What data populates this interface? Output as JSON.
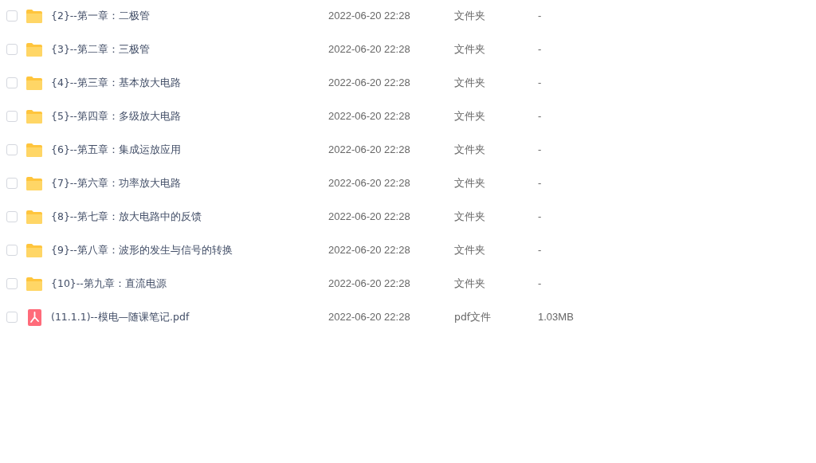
{
  "files": [
    {
      "kind": "folder",
      "checked": false,
      "name": "{2}--第一章：二极管",
      "modified": "2022-06-20 22:28",
      "type": "文件夹",
      "size": "-"
    },
    {
      "kind": "folder",
      "checked": false,
      "name": "{3}--第二章：三极管",
      "modified": "2022-06-20 22:28",
      "type": "文件夹",
      "size": "-"
    },
    {
      "kind": "folder",
      "checked": false,
      "name": "{4}--第三章：基本放大电路",
      "modified": "2022-06-20 22:28",
      "type": "文件夹",
      "size": "-"
    },
    {
      "kind": "folder",
      "checked": false,
      "name": "{5}--第四章：多级放大电路",
      "modified": "2022-06-20 22:28",
      "type": "文件夹",
      "size": "-"
    },
    {
      "kind": "folder",
      "checked": false,
      "name": "{6}--第五章：集成运放应用",
      "modified": "2022-06-20 22:28",
      "type": "文件夹",
      "size": "-"
    },
    {
      "kind": "folder",
      "checked": false,
      "name": "{7}--第六章：功率放大电路",
      "modified": "2022-06-20 22:28",
      "type": "文件夹",
      "size": "-"
    },
    {
      "kind": "folder",
      "checked": false,
      "name": "{8}--第七章：放大电路中的反馈",
      "modified": "2022-06-20 22:28",
      "type": "文件夹",
      "size": "-"
    },
    {
      "kind": "folder",
      "checked": false,
      "name": "{9}--第八章：波形的发生与信号的转换",
      "modified": "2022-06-20 22:28",
      "type": "文件夹",
      "size": "-"
    },
    {
      "kind": "folder",
      "checked": false,
      "name": "{10}--第九章：直流电源",
      "modified": "2022-06-20 22:28",
      "type": "文件夹",
      "size": "-"
    },
    {
      "kind": "pdf",
      "checked": false,
      "name": "(11.1.1)--模电—随课笔记.pdf",
      "modified": "2022-06-20 22:28",
      "type": "pdf文件",
      "size": "1.03MB"
    }
  ]
}
